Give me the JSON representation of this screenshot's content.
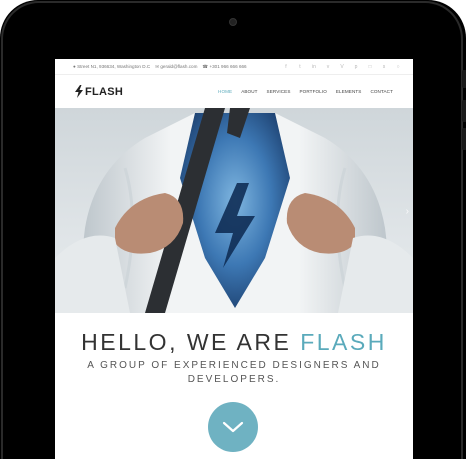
{
  "topbar": {
    "address": "Street N1, 936634, Washington D.C",
    "email": "gerald@flash.com",
    "phone": "+301 966 666 666",
    "social_icons": [
      "facebook-icon",
      "twitter-icon",
      "linkedin-icon",
      "vimeo-icon",
      "vine-icon",
      "pinterest-icon",
      "instagram-icon",
      "skype-icon",
      "dribbble-icon"
    ]
  },
  "navbar": {
    "logo_text": "FLASH",
    "menu": [
      {
        "label": "HOME",
        "active": true
      },
      {
        "label": "ABOUT",
        "active": false
      },
      {
        "label": "SERVICES",
        "active": false
      },
      {
        "label": "PORTFOLIO",
        "active": false
      },
      {
        "label": "ELEMENTS",
        "active": false
      },
      {
        "label": "CONTACT",
        "active": false
      }
    ]
  },
  "hero": {
    "next_icon": "chevron-right-icon"
  },
  "headline": {
    "prefix": "HELLO, WE ARE ",
    "accent": "FLASH"
  },
  "subheadline": "A GROUP OF EXPERIENCED DESIGNERS AND DEVELOPERS.",
  "scroll_button_icon": "chevron-down-icon",
  "colors": {
    "accent": "#5aaabb",
    "scroll_button": "#6fb2c2",
    "bezel": "#000000"
  }
}
